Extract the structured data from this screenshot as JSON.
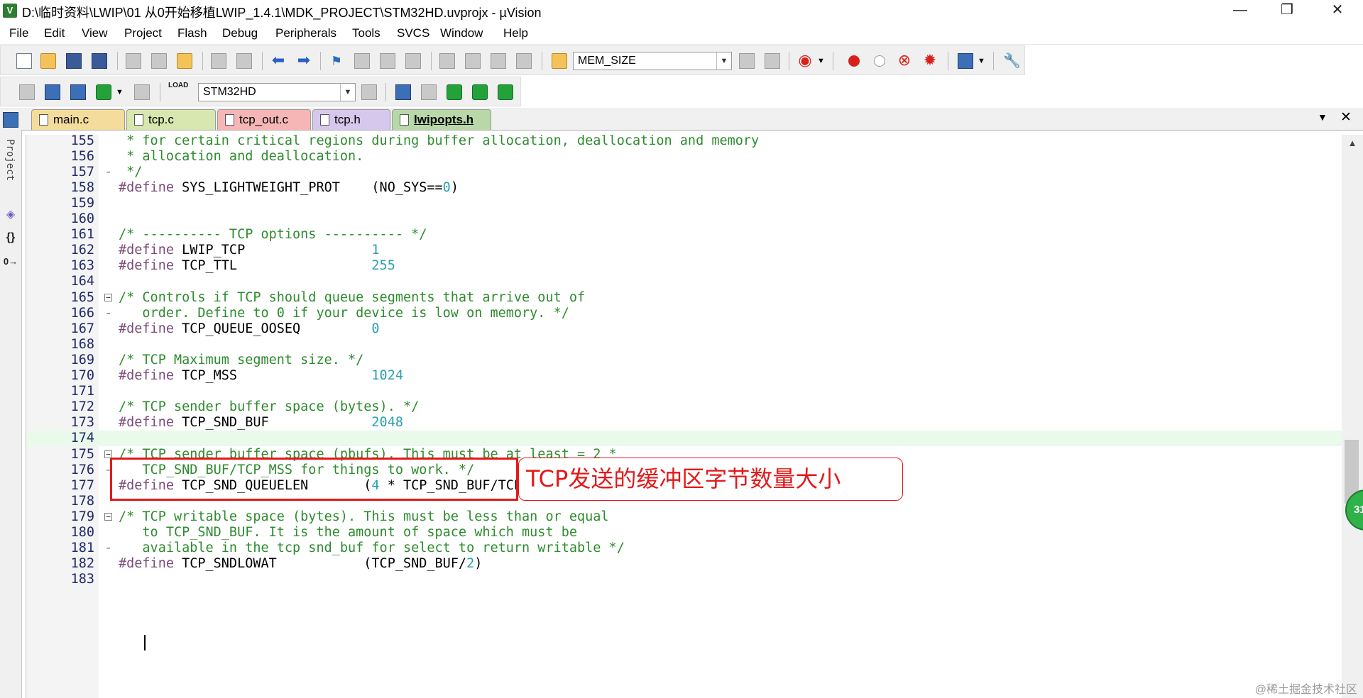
{
  "window": {
    "title": "D:\\临时资料\\LWIP\\01 从0开始移植LWIP_1.4.1\\MDK_PROJECT\\STM32HD.uvprojx - µVision",
    "app_icon": "V",
    "minimize_glyph": "—",
    "restore_glyph": "❐",
    "close_glyph": "✕"
  },
  "menu": [
    "File",
    "Edit",
    "View",
    "Project",
    "Flash",
    "Debug",
    "Peripherals",
    "Tools",
    "SVCS",
    "Window",
    "Help"
  ],
  "toolbar1": {
    "find_combo_value": "MEM_SIZE"
  },
  "toolbar2": {
    "load_label": "LOAD",
    "target_combo_value": "STM32HD"
  },
  "left_panel": {
    "project_label": "Project",
    "braces_glyph": "{}",
    "templates_glyph": "0→"
  },
  "tabs": [
    {
      "label": "main.c",
      "color": "#f4dc9c",
      "active": false
    },
    {
      "label": "tcp.c",
      "color": "#d8e6b0",
      "active": false
    },
    {
      "label": "tcp_out.c",
      "color": "#f6b6b6",
      "active": false
    },
    {
      "label": "tcp.h",
      "color": "#d6c8ec",
      "active": false
    },
    {
      "label": "lwipopts.h",
      "color": "#b8d8a8",
      "active": true
    }
  ],
  "tab_controls": {
    "dropdown_glyph": "▼",
    "close_glyph": "✕"
  },
  "code_lines": [
    {
      "n": "155",
      "fold": "",
      "current": false,
      "tokens": [
        {
          "t": " * for certain critical regions during buffer allocation, deallocation and memory",
          "c": "comment"
        }
      ]
    },
    {
      "n": "156",
      "fold": "",
      "current": false,
      "tokens": [
        {
          "t": " * allocation and deallocation.",
          "c": "comment"
        }
      ]
    },
    {
      "n": "157",
      "fold": "-",
      "current": false,
      "tokens": [
        {
          "t": " */",
          "c": "comment"
        }
      ]
    },
    {
      "n": "158",
      "fold": "",
      "current": false,
      "tokens": [
        {
          "t": "#define",
          "c": "directive"
        },
        {
          "t": " SYS_LIGHTWEIGHT_PROT    (NO_SYS==",
          "c": "ident"
        },
        {
          "t": "0",
          "c": "number"
        },
        {
          "t": ")",
          "c": "ident"
        }
      ]
    },
    {
      "n": "159",
      "fold": "",
      "current": false,
      "tokens": []
    },
    {
      "n": "160",
      "fold": "",
      "current": false,
      "tokens": []
    },
    {
      "n": "161",
      "fold": "",
      "current": false,
      "tokens": [
        {
          "t": "/* ---------- TCP options ---------- */",
          "c": "comment"
        }
      ]
    },
    {
      "n": "162",
      "fold": "",
      "current": false,
      "tokens": [
        {
          "t": "#define",
          "c": "directive"
        },
        {
          "t": " LWIP_TCP                ",
          "c": "ident"
        },
        {
          "t": "1",
          "c": "number"
        }
      ]
    },
    {
      "n": "163",
      "fold": "",
      "current": false,
      "tokens": [
        {
          "t": "#define",
          "c": "directive"
        },
        {
          "t": " TCP_TTL                 ",
          "c": "ident"
        },
        {
          "t": "255",
          "c": "number"
        }
      ]
    },
    {
      "n": "164",
      "fold": "",
      "current": false,
      "tokens": []
    },
    {
      "n": "165",
      "fold": "box",
      "current": false,
      "tokens": [
        {
          "t": "/* Controls if TCP should queue segments that arrive out of",
          "c": "comment"
        }
      ]
    },
    {
      "n": "166",
      "fold": "-",
      "current": false,
      "tokens": [
        {
          "t": "   order. Define to 0 if your device is low on memory. */",
          "c": "comment"
        }
      ]
    },
    {
      "n": "167",
      "fold": "",
      "current": false,
      "tokens": [
        {
          "t": "#define",
          "c": "directive"
        },
        {
          "t": " TCP_QUEUE_OOSEQ         ",
          "c": "ident"
        },
        {
          "t": "0",
          "c": "number"
        }
      ]
    },
    {
      "n": "168",
      "fold": "",
      "current": false,
      "tokens": []
    },
    {
      "n": "169",
      "fold": "",
      "current": false,
      "tokens": [
        {
          "t": "/* TCP Maximum segment size. */",
          "c": "comment"
        }
      ]
    },
    {
      "n": "170",
      "fold": "",
      "current": false,
      "tokens": [
        {
          "t": "#define",
          "c": "directive"
        },
        {
          "t": " TCP_MSS                 ",
          "c": "ident"
        },
        {
          "t": "1024",
          "c": "number"
        }
      ]
    },
    {
      "n": "171",
      "fold": "",
      "current": false,
      "tokens": []
    },
    {
      "n": "172",
      "fold": "",
      "current": false,
      "tokens": [
        {
          "t": "/* TCP sender buffer space (bytes). */",
          "c": "comment"
        }
      ]
    },
    {
      "n": "173",
      "fold": "",
      "current": false,
      "tokens": [
        {
          "t": "#define",
          "c": "directive"
        },
        {
          "t": " TCP_SND_BUF             ",
          "c": "ident"
        },
        {
          "t": "2048",
          "c": "number"
        }
      ]
    },
    {
      "n": "174",
      "fold": "",
      "current": true,
      "tokens": []
    },
    {
      "n": "175",
      "fold": "box",
      "current": false,
      "tokens": [
        {
          "t": "/* TCP sender buffer space (pbufs). This must be at least = 2 *",
          "c": "comment"
        }
      ]
    },
    {
      "n": "176",
      "fold": "-",
      "current": false,
      "tokens": [
        {
          "t": "   TCP_SND_BUF/TCP_MSS for things to work. */",
          "c": "comment"
        }
      ]
    },
    {
      "n": "177",
      "fold": "",
      "current": false,
      "tokens": [
        {
          "t": "#define",
          "c": "directive"
        },
        {
          "t": " TCP_SND_QUEUELEN       (",
          "c": "ident"
        },
        {
          "t": "4",
          "c": "number"
        },
        {
          "t": " * TCP_SND_BUF/TCP_MSS)",
          "c": "ident"
        }
      ]
    },
    {
      "n": "178",
      "fold": "",
      "current": false,
      "tokens": []
    },
    {
      "n": "179",
      "fold": "box",
      "current": false,
      "tokens": [
        {
          "t": "/* TCP writable space (bytes). This must be less than or equal",
          "c": "comment"
        }
      ]
    },
    {
      "n": "180",
      "fold": "",
      "current": false,
      "tokens": [
        {
          "t": "   to TCP_SND_BUF. It is the amount of space which must be",
          "c": "comment"
        }
      ]
    },
    {
      "n": "181",
      "fold": "-",
      "current": false,
      "tokens": [
        {
          "t": "   available in the tcp snd_buf for select to return writable */",
          "c": "comment"
        }
      ]
    },
    {
      "n": "182",
      "fold": "",
      "current": false,
      "tokens": [
        {
          "t": "#define",
          "c": "directive"
        },
        {
          "t": " TCP_SNDLOWAT           (TCP_SND_BUF/",
          "c": "ident"
        },
        {
          "t": "2",
          "c": "number"
        },
        {
          "t": ")",
          "c": "ident"
        }
      ]
    },
    {
      "n": "183",
      "fold": "",
      "current": false,
      "tokens": []
    }
  ],
  "annotation": {
    "callout_text": "TCP发送的缓冲区字节数量大小",
    "color": "#e21a1a"
  },
  "scroll_badge": "31",
  "watermark": "@稀土掘金技术社区"
}
